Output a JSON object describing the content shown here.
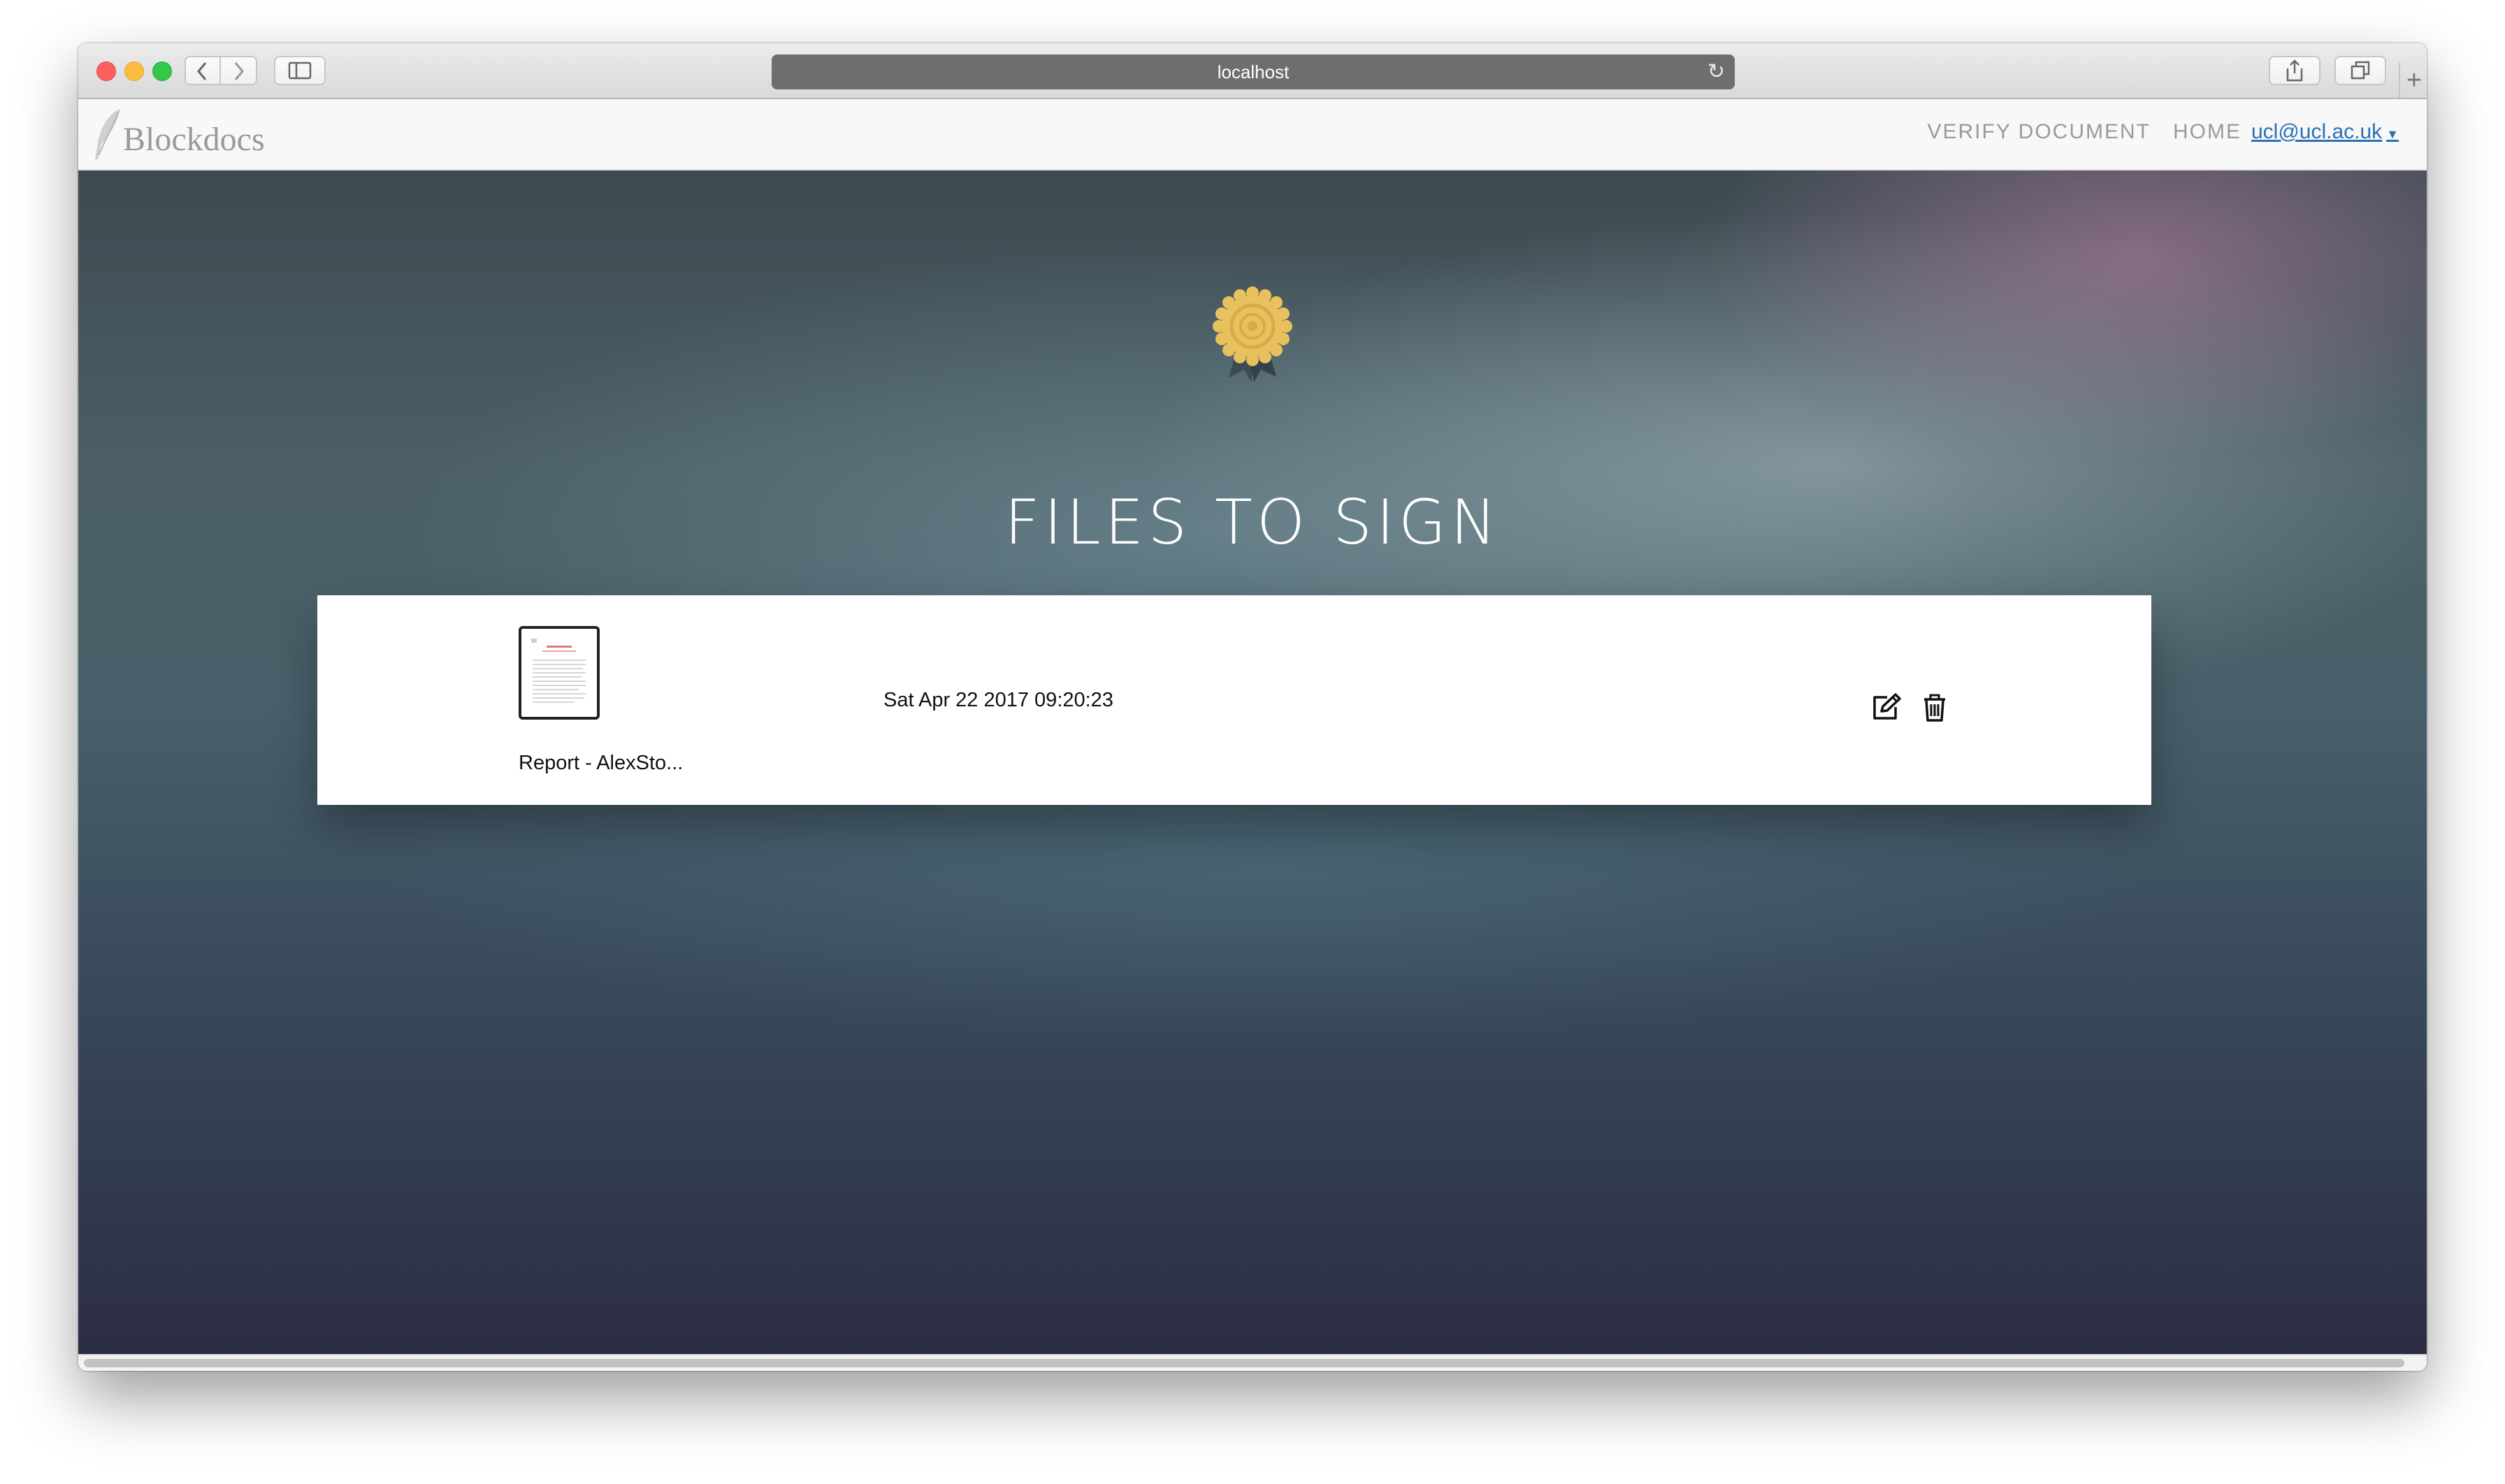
{
  "browser": {
    "address": "localhost",
    "icons": {
      "back": "chevron-left-icon",
      "forward": "chevron-right-icon",
      "sidebar": "sidebar-icon",
      "reload": "reload-icon",
      "share": "share-icon",
      "tabs": "tabs-icon",
      "new_tab": "plus-icon"
    }
  },
  "navbar": {
    "brand": "Blockdocs",
    "links": {
      "verify": "VERIFY DOCUMENT",
      "home": "HOME"
    },
    "user": "ucl@ucl.ac.uk"
  },
  "hero": {
    "title": "FILES TO SIGN"
  },
  "files": [
    {
      "name": "Report - AlexSto...",
      "date": "Sat Apr 22 2017 09:20:23"
    }
  ],
  "colors": {
    "accent_link": "#2a6fb8",
    "seal": "#e8c15e",
    "hero_title": "#ffffff"
  }
}
